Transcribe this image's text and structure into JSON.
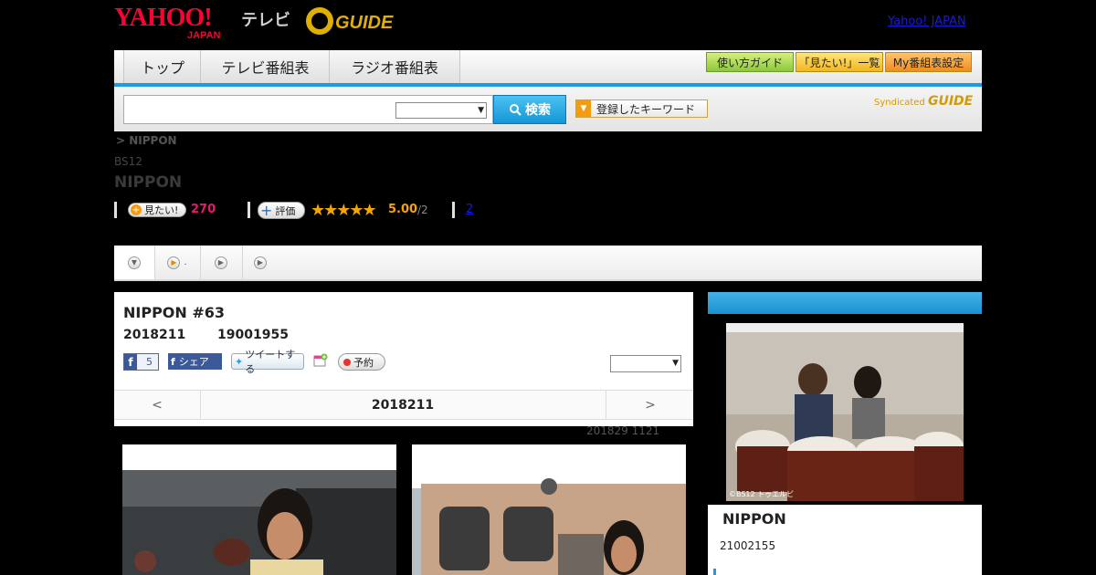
{
  "header": {
    "yahoo_logo": "YAHOO!",
    "yahoo_logo_sub": "JAPAN",
    "tv_label": "テレビ",
    "gguide_logo": "GUIDE",
    "yahoo_japan_link": "Yahoo! JAPAN"
  },
  "nav": {
    "tabs": [
      "トップ",
      "テレビ番組表",
      "ラジオ番組表"
    ],
    "buttons": [
      "使い方ガイド",
      "「見たい!」一覧",
      "My番組表設定"
    ]
  },
  "search": {
    "button_label": "検索",
    "keyword_button": "登録したキーワード",
    "syndicated": "Syndicated"
  },
  "program": {
    "breadcrumb": "> NIPPON",
    "station": "BS12",
    "title": "NIPPON",
    "mitai_label": "見たい!",
    "mitai_count": "270",
    "hyouka_label": "評価",
    "rating_stars": 5,
    "rating_value": "5.00",
    "rating_count": "/2",
    "review_link": "2"
  },
  "episode": {
    "title": "NIPPON #63",
    "date": "2018211",
    "time": "19001955",
    "fb_count": "5",
    "fb_share": "シェア",
    "tweet": "ツイートする",
    "reserve": "予約",
    "nav_prev": "<",
    "nav_date": "2018211",
    "nav_next": ">",
    "updated": "201829  1121"
  },
  "sidebar": {
    "title": "NIPPON",
    "time": "21002155",
    "photo_credit": "©BS12 トゥエルビ"
  },
  "colors": {
    "accent_blue": "#1e9ae0",
    "yahoo_red": "#ff0033",
    "gguide_gold": "#e0b000",
    "mitai_pink": "#e8196e",
    "star_orange": "#f5a500"
  }
}
